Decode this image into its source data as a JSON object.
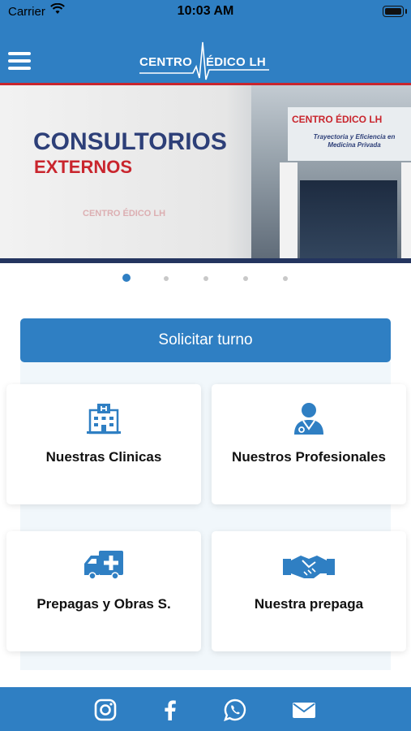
{
  "status_bar": {
    "carrier": "Carrier",
    "time": "10:03 AM"
  },
  "header": {
    "logo_left": "CENTRO",
    "logo_right": "ÉDICO LH",
    "menu_icon": "hamburger-menu-icon"
  },
  "banner": {
    "title_line1": "CONSULTORIOS",
    "title_line2": "EXTERNOS",
    "watermark": "CENTRO ÉDICO LH",
    "sign_title": "CENTRO ÉDICO LH",
    "sign_subtitle": "Trayectoria y Eficiencia en Medicina Privada"
  },
  "carousel": {
    "count": 5,
    "active_index": 0
  },
  "primary_button": {
    "label": "Solicitar turno"
  },
  "cards": [
    {
      "label": "Nuestras Clinicas",
      "icon": "hospital-icon"
    },
    {
      "label": "Nuestros Profesionales",
      "icon": "doctor-icon"
    },
    {
      "label": "Prepagas y Obras S.",
      "icon": "ambulance-icon"
    },
    {
      "label": "Nuestra prepaga",
      "icon": "handshake-icon"
    }
  ],
  "footer": {
    "icons": [
      "instagram-icon",
      "facebook-icon",
      "whatsapp-icon",
      "email-icon"
    ]
  },
  "colors": {
    "primary": "#2f7fc3",
    "accent_red": "#c9252d",
    "navy": "#2d3f78",
    "card_bg": "#ffffff",
    "panel_bg": "#f1f7fb"
  }
}
